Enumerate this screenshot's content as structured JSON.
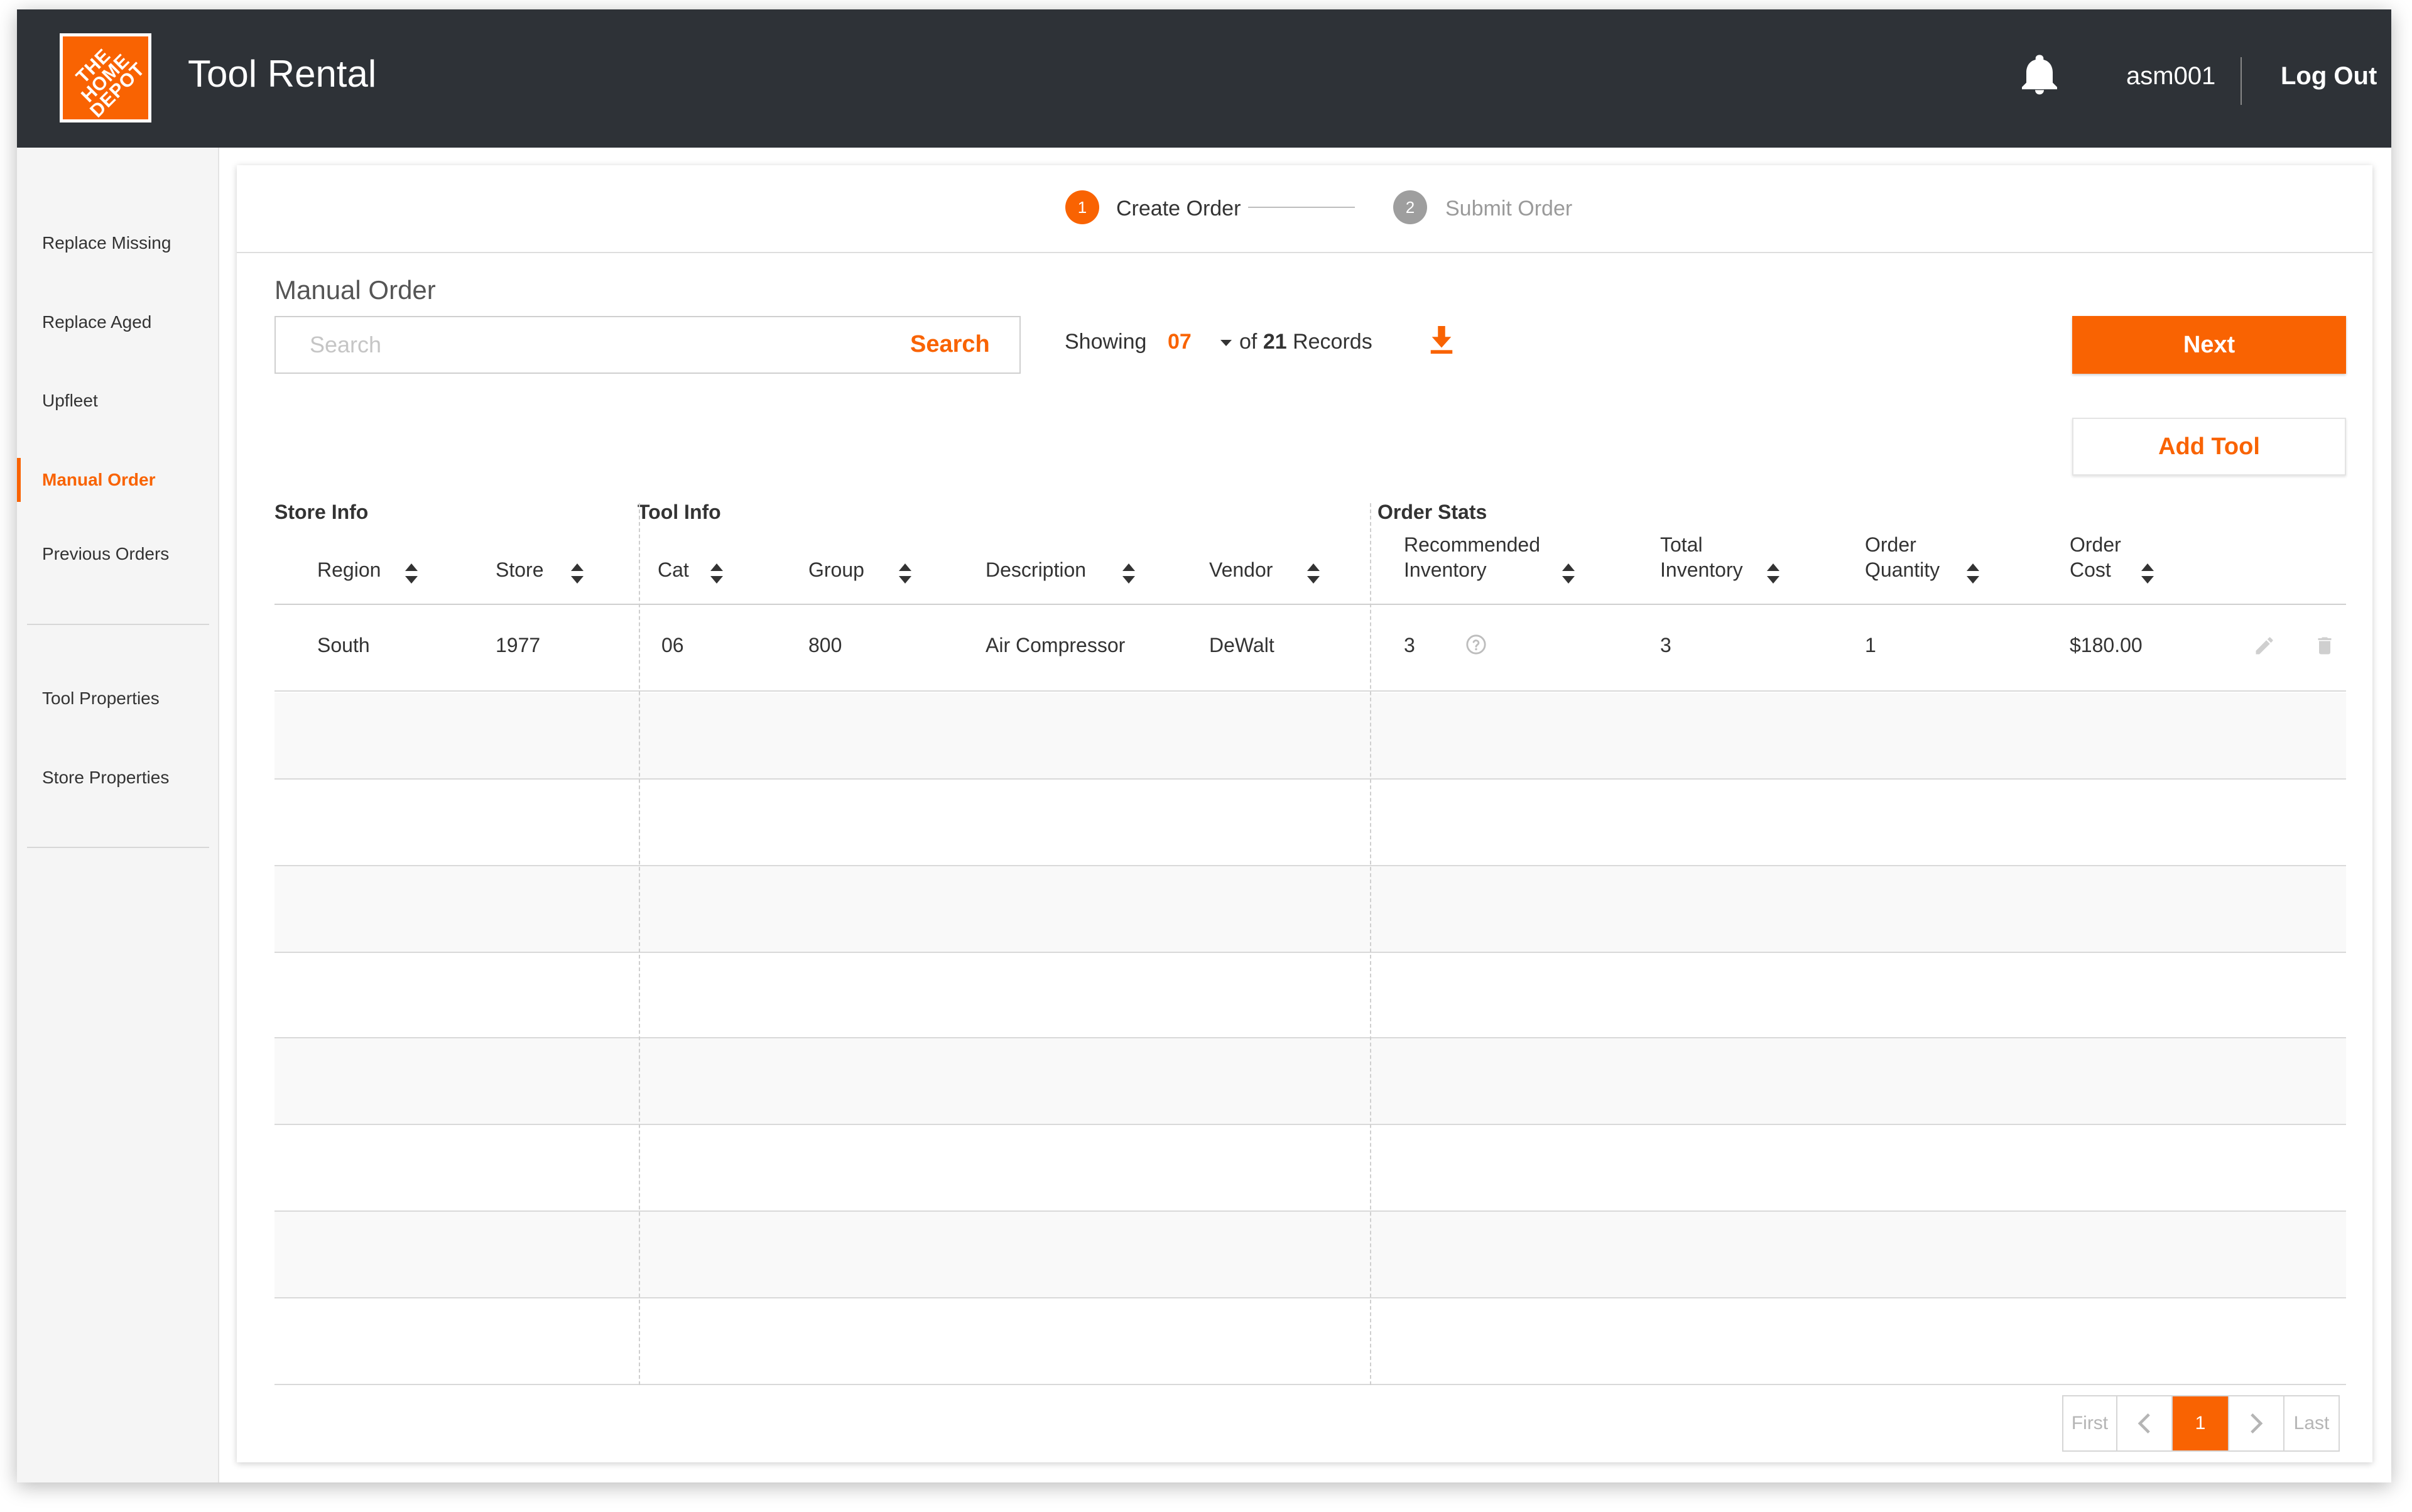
{
  "header": {
    "brand_logo_text": "THE HOME DEPOT",
    "app_title": "Tool Rental",
    "username": "asm001",
    "logout_label": "Log Out",
    "bell_icon": "bell-icon",
    "brand_color": "#f96302",
    "bar_color": "#2e3237"
  },
  "sidebar": {
    "items": [
      {
        "label": "Replace Missing",
        "active": false
      },
      {
        "label": "Replace Aged",
        "active": false
      },
      {
        "label": "Upfleet",
        "active": false
      },
      {
        "label": "Manual Order",
        "active": true
      },
      {
        "label": "Previous Orders",
        "active": false
      },
      {
        "label": "Tool Properties",
        "active": false
      },
      {
        "label": "Store Properties",
        "active": false
      }
    ]
  },
  "stepper": {
    "steps": [
      {
        "number": "1",
        "label": "Create Order",
        "state": "active"
      },
      {
        "number": "2",
        "label": "Submit Order",
        "state": "inactive"
      }
    ]
  },
  "main": {
    "title": "Manual Order",
    "search": {
      "placeholder": "Search",
      "value": "",
      "button_label": "Search"
    },
    "showing_label": "Showing",
    "showing_value": "07",
    "records_prefix": "of",
    "records_total": "21",
    "records_suffix": "Records",
    "download_icon": "download-icon",
    "next_label": "Next",
    "add_tool_label": "Add Tool"
  },
  "table": {
    "groups": [
      "Store Info",
      "Tool Info",
      "Order Stats"
    ],
    "columns": [
      {
        "line1": "Region",
        "line2": ""
      },
      {
        "line1": "Store",
        "line2": ""
      },
      {
        "line1": "Cat",
        "line2": ""
      },
      {
        "line1": "Group",
        "line2": ""
      },
      {
        "line1": "Description",
        "line2": ""
      },
      {
        "line1": "Vendor",
        "line2": ""
      },
      {
        "line1": "Recommended",
        "line2": "Inventory"
      },
      {
        "line1": "Total",
        "line2": "Inventory"
      },
      {
        "line1": "Order",
        "line2": "Quantity"
      },
      {
        "line1": "Order",
        "line2": "Cost"
      }
    ],
    "rows": [
      {
        "region": "South",
        "store": "1977",
        "cat": "06",
        "group": "800",
        "description": "Air Compressor",
        "vendor": "DeWalt",
        "recommended_inventory": "3",
        "total_inventory": "3",
        "order_quantity": "1",
        "order_cost": "$180.00"
      }
    ],
    "empty_row_count": 8,
    "row_icons": [
      "help-icon",
      "edit-icon",
      "trash-icon"
    ]
  },
  "pagination": {
    "first_label": "First",
    "prev_icon": "chevron-left-icon",
    "current_page": "1",
    "next_icon": "chevron-right-icon",
    "last_label": "Last"
  }
}
